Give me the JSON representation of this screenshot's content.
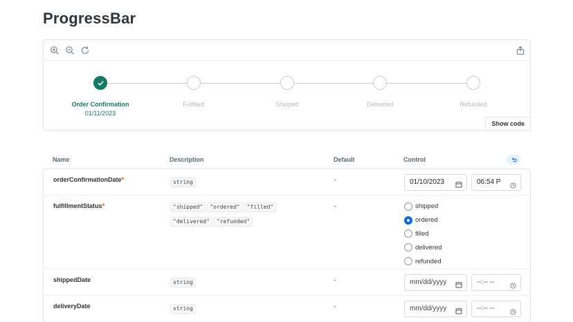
{
  "page": {
    "title": "ProgressBar"
  },
  "toolbar": {
    "zoom_in": "zoom-in-icon",
    "zoom_out": "zoom-out-icon",
    "reset_zoom": "reset-zoom-icon",
    "share": "share-icon"
  },
  "stepper": {
    "accent": "#117a65",
    "steps": [
      {
        "label": "Order Confirmation",
        "date": "01/11/2023",
        "completed": true
      },
      {
        "label": "Fulfilled",
        "date": "",
        "completed": false
      },
      {
        "label": "Shipped",
        "date": "",
        "completed": false
      },
      {
        "label": "Delivered",
        "date": "",
        "completed": false
      },
      {
        "label": "Refunded",
        "date": "",
        "completed": false
      }
    ]
  },
  "preview": {
    "show_code_label": "Show code"
  },
  "args": {
    "headers": {
      "name": "Name",
      "description": "Description",
      "default": "Default",
      "control": "Control"
    },
    "rows": [
      {
        "name": "orderConfirmationDate",
        "required": true,
        "types": [
          "string"
        ],
        "default": "-",
        "date_value": "01/10/2023",
        "time_value": "06:54 P"
      },
      {
        "name": "fulfillmentStatus",
        "required": true,
        "types": [
          "\"shipped\"",
          "\"ordered\"",
          "\"filled\"",
          "\"delivered\"",
          "\"refunded\""
        ],
        "default": "-",
        "options": [
          "shipped",
          "ordered",
          "filled",
          "delivered",
          "refunded"
        ],
        "selected": "ordered"
      },
      {
        "name": "shippedDate",
        "required": false,
        "types": [
          "string"
        ],
        "default": "-",
        "date_value": "mm/dd/yyyy",
        "time_value": "--:-- --"
      },
      {
        "name": "deliveryDate",
        "required": false,
        "types": [
          "string"
        ],
        "default": "-",
        "date_value": "mm/dd/yyyy",
        "time_value": "--:-- --"
      }
    ],
    "required_mark": "*"
  }
}
